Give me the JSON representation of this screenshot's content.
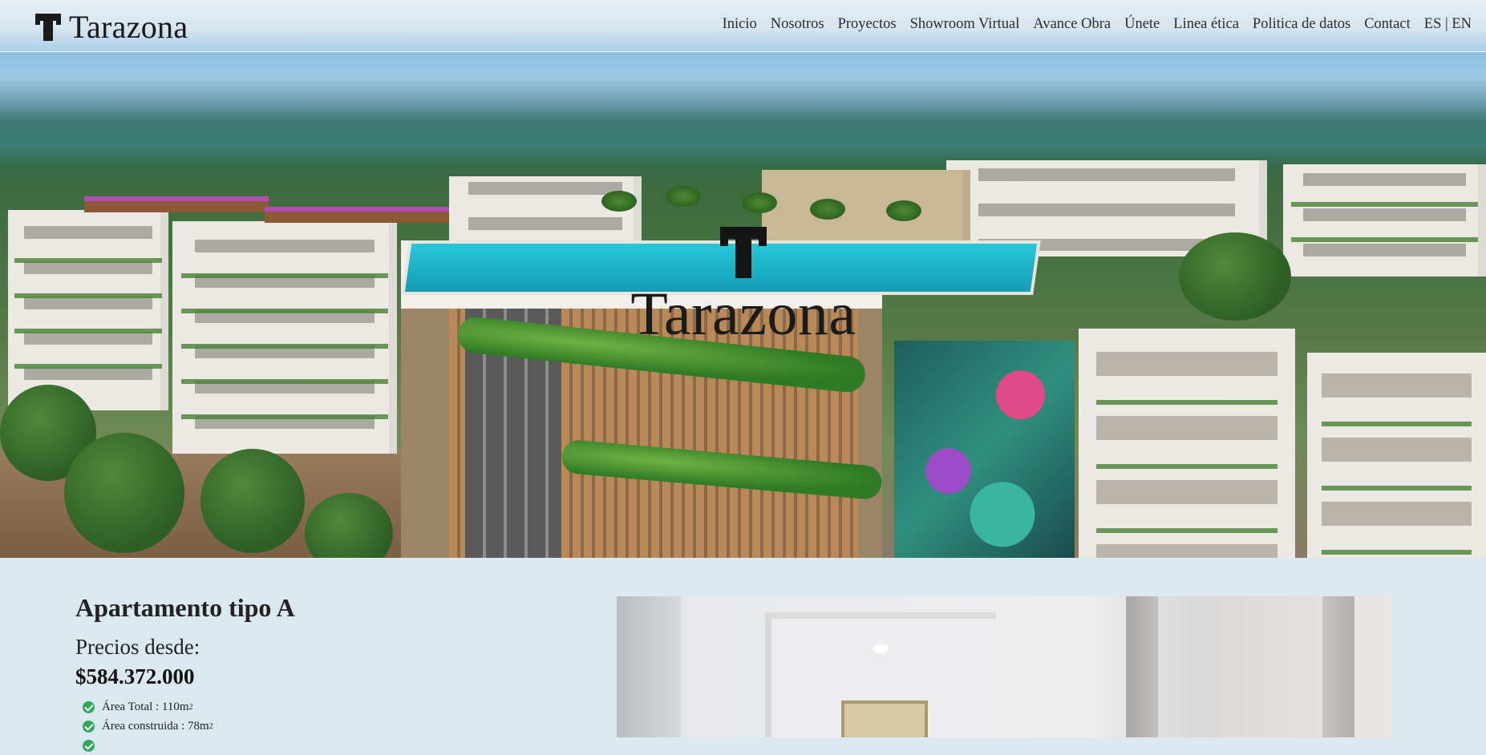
{
  "header": {
    "brand_name": "Tarazona",
    "nav": [
      {
        "label": "Inicio"
      },
      {
        "label": "Nosotros"
      },
      {
        "label": "Proyectos"
      },
      {
        "label": "Showroom Virtual"
      },
      {
        "label": "Avance Obra"
      },
      {
        "label": "Únete"
      },
      {
        "label": "Linea ética"
      },
      {
        "label": "Politica de datos"
      },
      {
        "label": "Contact"
      }
    ],
    "lang_es": "ES",
    "lang_sep": "|",
    "lang_en": "EN"
  },
  "hero": {
    "title": "Tarazona"
  },
  "apartment": {
    "title": "Apartamento tipo A",
    "price_label": "Precios desde:",
    "price_value": "$584.372.000",
    "features": [
      {
        "label": "Área Total : 110m",
        "sup": "2"
      },
      {
        "label": "Área construida : 78m",
        "sup": "2"
      }
    ]
  },
  "icons": {
    "feature_icon": "check-circle-icon",
    "brand_icon": "t-logo-icon"
  },
  "colors": {
    "background": "#dbe8ee",
    "check_green": "#2fa75d",
    "text_dark": "#1c1c1c"
  }
}
